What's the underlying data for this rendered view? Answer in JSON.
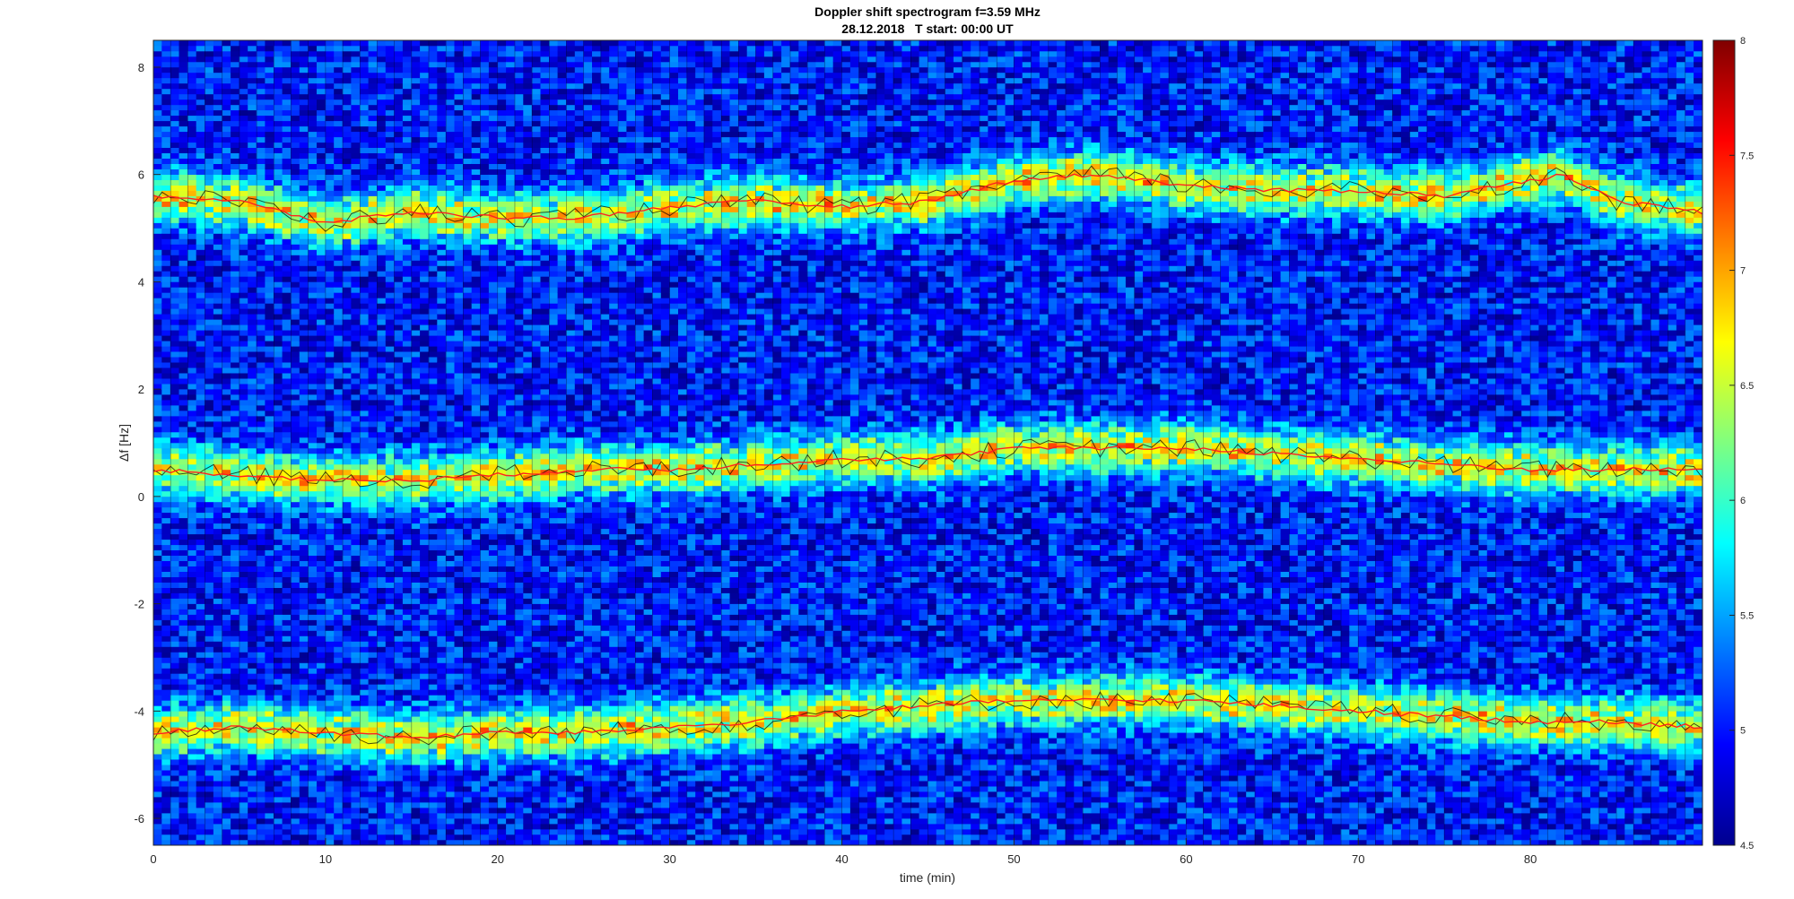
{
  "chart_data": {
    "type": "heatmap",
    "title": "Doppler shift spectrogram f=3.59 MHz",
    "subtitle": "28.12.2018   T start: 00:00 UT",
    "xlabel": "time (min)",
    "ylabel": "Δf [Hz]",
    "xlim": [
      0,
      90
    ],
    "ylim": [
      -6.5,
      8.5
    ],
    "xticks": [
      0,
      10,
      20,
      30,
      40,
      50,
      60,
      70,
      80
    ],
    "yticks": [
      -6,
      -4,
      -2,
      0,
      2,
      4,
      6,
      8
    ],
    "colorbar": {
      "colormap": "jet",
      "clim": [
        4.5,
        8
      ],
      "ticks": [
        "4.5",
        "5",
        "5.5",
        "6",
        "6.5",
        "7",
        "7.5",
        "8"
      ]
    },
    "grid": false,
    "background_level": 5.0,
    "bands": [
      {
        "name": "",
        "level": 6.6,
        "half_width_hz": 0.45,
        "center_hz": [
          [
            0,
            5.6
          ],
          [
            5,
            5.5
          ],
          [
            10,
            5.1
          ],
          [
            15,
            5.3
          ],
          [
            20,
            5.2
          ],
          [
            25,
            5.2
          ],
          [
            30,
            5.4
          ],
          [
            35,
            5.5
          ],
          [
            40,
            5.4
          ],
          [
            45,
            5.5
          ],
          [
            50,
            5.9
          ],
          [
            55,
            6.0
          ],
          [
            60,
            5.8
          ],
          [
            65,
            5.7
          ],
          [
            70,
            5.7
          ],
          [
            75,
            5.6
          ],
          [
            80,
            5.9
          ],
          [
            82,
            6.0
          ],
          [
            85,
            5.5
          ],
          [
            90,
            5.3
          ]
        ]
      },
      {
        "name": "",
        "level": 6.6,
        "half_width_hz": 0.45,
        "center_hz": [
          [
            0,
            0.5
          ],
          [
            5,
            0.4
          ],
          [
            10,
            0.3
          ],
          [
            15,
            0.3
          ],
          [
            20,
            0.4
          ],
          [
            25,
            0.5
          ],
          [
            30,
            0.5
          ],
          [
            35,
            0.6
          ],
          [
            40,
            0.7
          ],
          [
            45,
            0.7
          ],
          [
            50,
            0.9
          ],
          [
            55,
            0.9
          ],
          [
            60,
            0.9
          ],
          [
            65,
            0.8
          ],
          [
            70,
            0.7
          ],
          [
            75,
            0.6
          ],
          [
            80,
            0.5
          ],
          [
            85,
            0.5
          ],
          [
            90,
            0.5
          ]
        ]
      },
      {
        "name": "",
        "level": 6.6,
        "half_width_hz": 0.45,
        "center_hz": [
          [
            0,
            -4.4
          ],
          [
            5,
            -4.3
          ],
          [
            10,
            -4.4
          ],
          [
            15,
            -4.5
          ],
          [
            20,
            -4.4
          ],
          [
            25,
            -4.4
          ],
          [
            30,
            -4.3
          ],
          [
            35,
            -4.2
          ],
          [
            40,
            -4.0
          ],
          [
            45,
            -3.9
          ],
          [
            50,
            -3.8
          ],
          [
            55,
            -3.8
          ],
          [
            60,
            -3.8
          ],
          [
            65,
            -3.9
          ],
          [
            70,
            -4.0
          ],
          [
            75,
            -4.1
          ],
          [
            80,
            -4.2
          ],
          [
            85,
            -4.2
          ],
          [
            90,
            -4.3
          ]
        ]
      }
    ],
    "ridge_line_color": "#ff2020",
    "trace_line_color": "#000000"
  }
}
